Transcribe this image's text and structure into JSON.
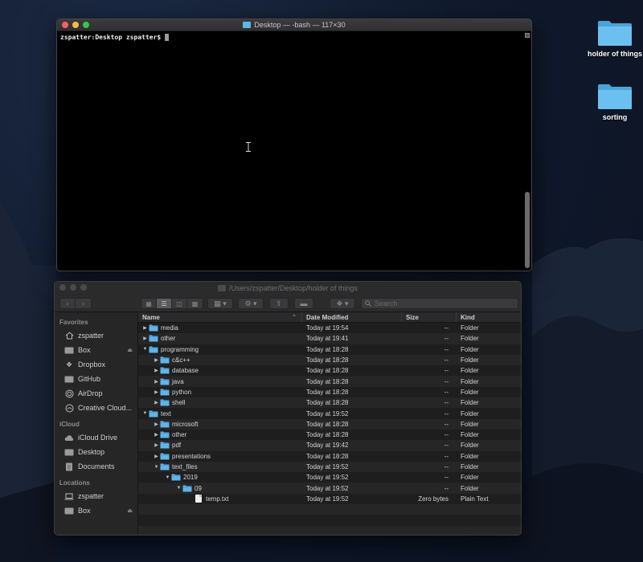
{
  "desktop": {
    "icons": [
      {
        "label": "holder of things"
      },
      {
        "label": "sorting"
      }
    ]
  },
  "terminal": {
    "title": "Desktop — -bash — 117×30",
    "prompt": "zspatter:Desktop zspatter$"
  },
  "finder": {
    "title": "/Users/zspatter/Desktop/holder of things",
    "search_placeholder": "Search",
    "sidebar": {
      "favorites_header": "Favorites",
      "favorites": [
        "zspatter",
        "Box",
        "Dropbox",
        "GitHub",
        "AirDrop",
        "Creative Cloud..."
      ],
      "icloud_header": "iCloud",
      "icloud": [
        "iCloud Drive",
        "Desktop",
        "Documents"
      ],
      "locations_header": "Locations",
      "locations": [
        "zspatter",
        "Box"
      ]
    },
    "columns": {
      "name": "Name",
      "date": "Date Modified",
      "size": "Size",
      "kind": "Kind"
    },
    "rows": [
      {
        "name": "media",
        "date": "Today at 19:54",
        "size": "--",
        "kind": "Folder",
        "indent": 0,
        "expanded": false,
        "type": "folder"
      },
      {
        "name": "other",
        "date": "Today at 19:41",
        "size": "--",
        "kind": "Folder",
        "indent": 0,
        "expanded": false,
        "type": "folder"
      },
      {
        "name": "programming",
        "date": "Today at 18:28",
        "size": "--",
        "kind": "Folder",
        "indent": 0,
        "expanded": true,
        "type": "folder"
      },
      {
        "name": "c&c++",
        "date": "Today at 18:28",
        "size": "--",
        "kind": "Folder",
        "indent": 1,
        "expanded": false,
        "type": "folder"
      },
      {
        "name": "database",
        "date": "Today at 18:28",
        "size": "--",
        "kind": "Folder",
        "indent": 1,
        "expanded": false,
        "type": "folder"
      },
      {
        "name": "java",
        "date": "Today at 18:28",
        "size": "--",
        "kind": "Folder",
        "indent": 1,
        "expanded": false,
        "type": "folder"
      },
      {
        "name": "python",
        "date": "Today at 18:28",
        "size": "--",
        "kind": "Folder",
        "indent": 1,
        "expanded": false,
        "type": "folder"
      },
      {
        "name": "shell",
        "date": "Today at 18:28",
        "size": "--",
        "kind": "Folder",
        "indent": 1,
        "expanded": false,
        "type": "folder"
      },
      {
        "name": "text",
        "date": "Today at 19:52",
        "size": "--",
        "kind": "Folder",
        "indent": 0,
        "expanded": true,
        "type": "folder"
      },
      {
        "name": "microsoft",
        "date": "Today at 18:28",
        "size": "--",
        "kind": "Folder",
        "indent": 1,
        "expanded": false,
        "type": "folder"
      },
      {
        "name": "other",
        "date": "Today at 18:28",
        "size": "--",
        "kind": "Folder",
        "indent": 1,
        "expanded": false,
        "type": "folder"
      },
      {
        "name": "pdf",
        "date": "Today at 19:42",
        "size": "--",
        "kind": "Folder",
        "indent": 1,
        "expanded": false,
        "type": "folder"
      },
      {
        "name": "presentations",
        "date": "Today at 18:28",
        "size": "--",
        "kind": "Folder",
        "indent": 1,
        "expanded": false,
        "type": "folder"
      },
      {
        "name": "text_files",
        "date": "Today at 19:52",
        "size": "--",
        "kind": "Folder",
        "indent": 1,
        "expanded": true,
        "type": "folder"
      },
      {
        "name": "2019",
        "date": "Today at 19:52",
        "size": "--",
        "kind": "Folder",
        "indent": 2,
        "expanded": true,
        "type": "folder"
      },
      {
        "name": "09",
        "date": "Today at 19:52",
        "size": "--",
        "kind": "Folder",
        "indent": 3,
        "expanded": true,
        "type": "folder"
      },
      {
        "name": "temp.txt",
        "date": "Today at 19:52",
        "size": "Zero bytes",
        "kind": "Plain Text",
        "indent": 4,
        "expanded": false,
        "type": "file"
      }
    ]
  },
  "colors": {
    "folder": "#5fb4e8",
    "terminal_bg": "#000000",
    "finder_bg": "#1e1e1f"
  }
}
